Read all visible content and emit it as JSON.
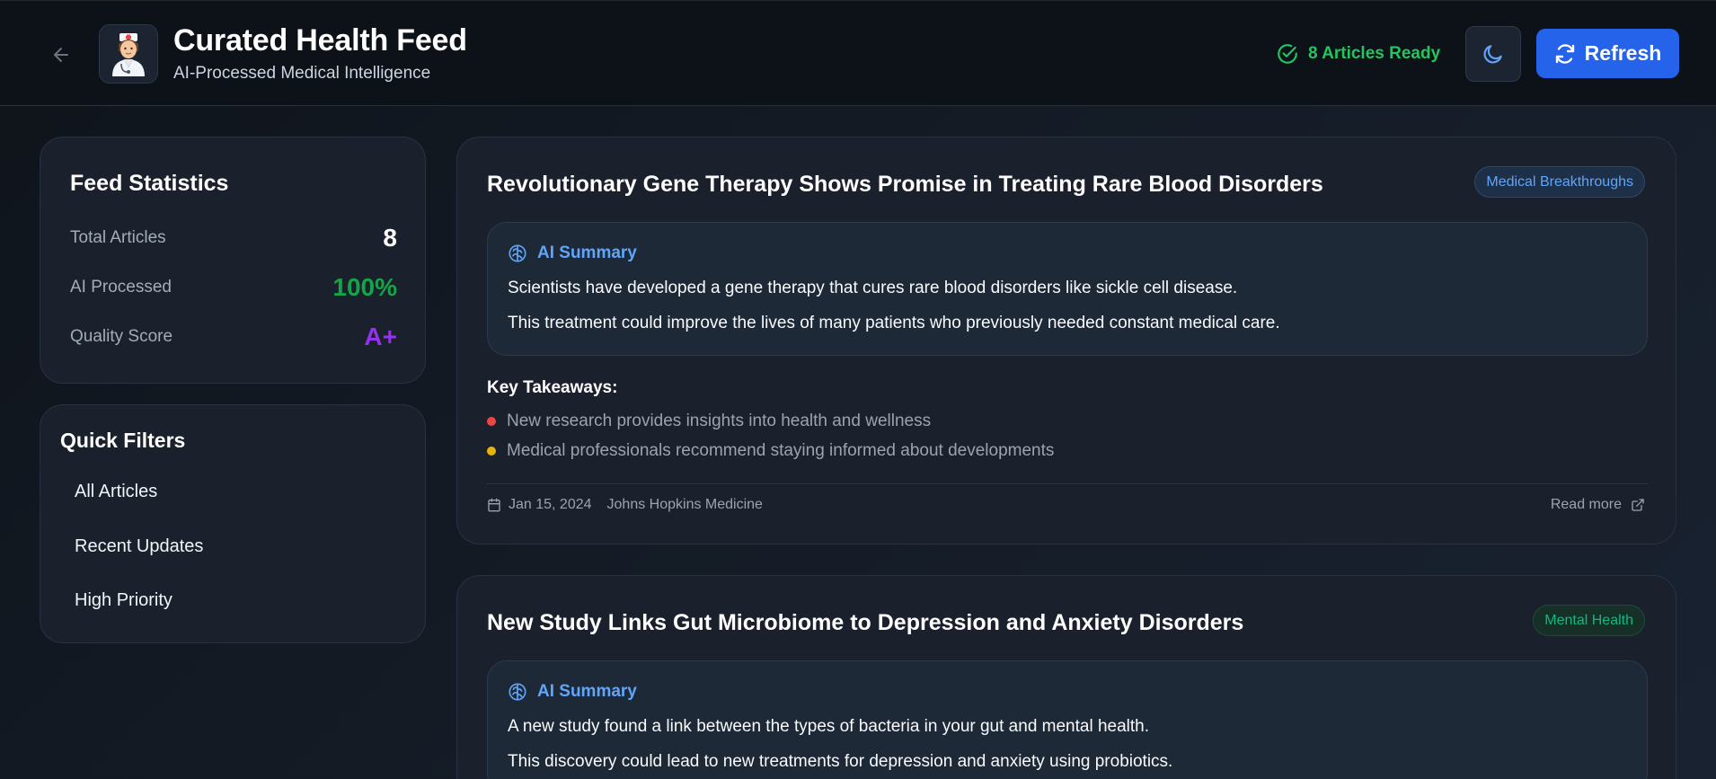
{
  "header": {
    "title": "Curated Health Feed",
    "subtitle": "AI-Processed Medical Intelligence",
    "logo_icon": "doctor-avatar-icon",
    "status_text": "8 Articles Ready",
    "refresh_label": "Refresh"
  },
  "stats": {
    "title": "Feed Statistics",
    "rows": [
      {
        "label": "Total Articles",
        "value": "8",
        "color": "#ffffff"
      },
      {
        "label": "AI Processed",
        "value": "100%",
        "color": "#16a34a"
      },
      {
        "label": "Quality Score",
        "value": "A+",
        "color": "#9333ea"
      }
    ]
  },
  "filters": {
    "title": "Quick Filters",
    "items": [
      "All Articles",
      "Recent Updates",
      "High Priority"
    ]
  },
  "articles": [
    {
      "title": "Revolutionary Gene Therapy Shows Promise in Treating Rare Blood Disorders",
      "tag": "Medical Breakthroughs",
      "summary_label": "AI Summary",
      "summary": [
        "Scientists have developed a gene therapy that cures rare blood disorders like sickle cell disease.",
        "This treatment could improve the lives of many patients who previously needed constant medical care."
      ],
      "takeaways_label": "Key Takeaways:",
      "takeaways": [
        {
          "text": "New research provides insights into health and wellness",
          "color": "#ef4444"
        },
        {
          "text": "Medical professionals recommend staying informed about developments",
          "color": "#eab308"
        }
      ],
      "date": "Jan 15, 2024",
      "source": "Johns Hopkins Medicine",
      "read_more": "Read more"
    },
    {
      "title": "New Study Links Gut Microbiome to Depression and Anxiety Disorders",
      "tag": "Mental Health",
      "summary_label": "AI Summary",
      "summary": [
        "A new study found a link between the types of bacteria in your gut and mental health.",
        "This discovery could lead to new treatments for depression and anxiety using probiotics."
      ]
    }
  ],
  "colors": {
    "accent": "#2563eb",
    "status": "#22c55e",
    "summary_accent": "#60a5fa"
  }
}
